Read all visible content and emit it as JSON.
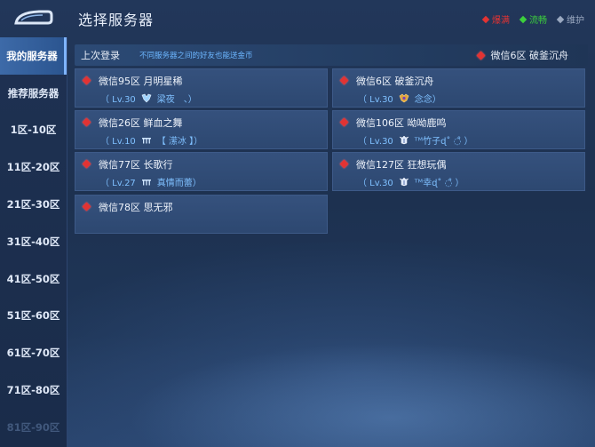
{
  "title": "选择服务器",
  "legend": [
    {
      "label": "爆满",
      "color": "#e23333"
    },
    {
      "label": "流畅",
      "color": "#3ccf3c"
    },
    {
      "label": "维护",
      "color": "#9aa8c0"
    }
  ],
  "sidebar": {
    "items": [
      {
        "label": "我的服务器",
        "active": true
      },
      {
        "label": "推荐服务器"
      },
      {
        "label": "1区-10区"
      },
      {
        "label": "11区-20区"
      },
      {
        "label": "21区-30区"
      },
      {
        "label": "31区-40区"
      },
      {
        "label": "41区-50区"
      },
      {
        "label": "51区-60区"
      },
      {
        "label": "61区-70区"
      },
      {
        "label": "71区-80区"
      },
      {
        "label": "81区-90区"
      }
    ]
  },
  "last_login": {
    "title": "上次登录",
    "hint": "不同服务器之间的好友也能送金币",
    "server": "微信6区 破釜沉舟"
  },
  "servers": [
    {
      "name": "微信95区 月明星稀",
      "level": "（ Lv.30",
      "role": "梁夜　、）",
      "rank_icon": "rank-diamond-icon",
      "status": "爆满"
    },
    {
      "name": "微信6区 破釜沉舟",
      "level": "（ Lv.30",
      "role": "念念）",
      "rank_icon": "rank-gold-icon",
      "status": "爆满"
    },
    {
      "name": "微信26区 鲜血之舞",
      "level": "（ Lv.10",
      "role": "【 潆冰 】）",
      "rank_icon": "rank-bronze-icon",
      "status": "爆满"
    },
    {
      "name": "微信106区 呦呦鹿鸣",
      "level": "（ Lv.30",
      "role": "ᵀᴹ竹子ɖ˚ ◌̊ ）",
      "rank_icon": "rank-platinum-icon",
      "status": "爆满"
    },
    {
      "name": "微信77区 长歌行",
      "level": "（ Lv.27",
      "role": "真情而蕾）",
      "rank_icon": "rank-bronze-icon",
      "status": "爆满"
    },
    {
      "name": "微信127区 狂想玩偶",
      "level": "（ Lv.30",
      "role": "ᵀᴹ幸ɖ˚ ◌̊ ）",
      "rank_icon": "rank-platinum-icon",
      "status": "爆满"
    },
    {
      "name": "微信78区 思无邪",
      "level": "",
      "role": "",
      "rank_icon": "",
      "status": "爆满"
    }
  ]
}
